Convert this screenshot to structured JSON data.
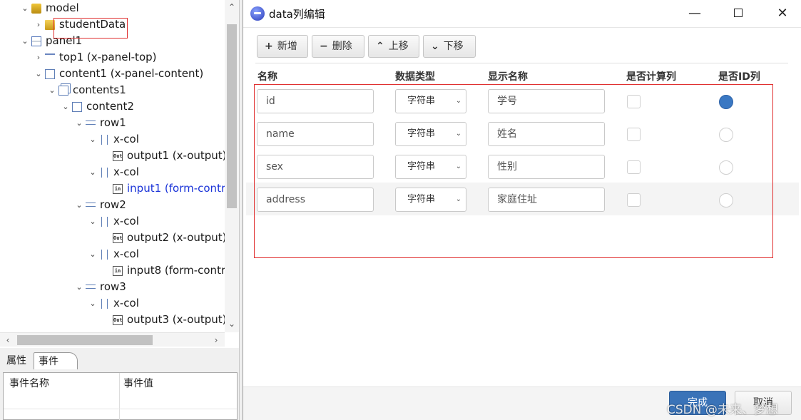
{
  "tree": {
    "items": [
      {
        "label": "model",
        "chevron": "⌄",
        "icon": "model"
      },
      {
        "label": "studentData",
        "chevron": "›",
        "icon": "data"
      },
      {
        "label": "panel1",
        "chevron": "⌄",
        "icon": "panel"
      },
      {
        "label": "top1 (x-panel-top)",
        "chevron": "›",
        "icon": "top"
      },
      {
        "label": "content1 (x-panel-content)",
        "chevron": "⌄",
        "icon": "square"
      },
      {
        "label": "contents1",
        "chevron": "⌄",
        "icon": "contents"
      },
      {
        "label": "content2",
        "chevron": "⌄",
        "icon": "square"
      },
      {
        "label": "row1",
        "chevron": "⌄",
        "icon": "row"
      },
      {
        "label": "x-col",
        "chevron": "⌄",
        "icon": "col"
      },
      {
        "label": "output1 (x-output)",
        "chevron": "",
        "icon": "out"
      },
      {
        "label": "x-col",
        "chevron": "⌄",
        "icon": "col"
      },
      {
        "label": "input1 (form-contr",
        "chevron": "",
        "icon": "in",
        "selected": true
      },
      {
        "label": "row2",
        "chevron": "⌄",
        "icon": "row"
      },
      {
        "label": "x-col",
        "chevron": "⌄",
        "icon": "col"
      },
      {
        "label": "output2 (x-output)",
        "chevron": "",
        "icon": "out"
      },
      {
        "label": "x-col",
        "chevron": "⌄",
        "icon": "col"
      },
      {
        "label": "input8 (form-contr",
        "chevron": "",
        "icon": "in"
      },
      {
        "label": "row3",
        "chevron": "⌄",
        "icon": "row"
      },
      {
        "label": "x-col",
        "chevron": "⌄",
        "icon": "col"
      },
      {
        "label": "output3 (x-output)",
        "chevron": "",
        "icon": "out"
      }
    ],
    "icon_text_out": "Out",
    "icon_text_in": "in"
  },
  "props": {
    "tab_properties": "属性",
    "tab_events": "事件",
    "col_event_name": "事件名称",
    "col_event_value": "事件值"
  },
  "dialog": {
    "title": "data列编辑",
    "toolbar": {
      "add": "新增",
      "delete": "删除",
      "move_up": "上移",
      "move_down": "下移"
    },
    "headers": {
      "name": "名称",
      "type": "数据类型",
      "display": "显示名称",
      "is_calc": "是否计算列",
      "is_id": "是否ID列"
    },
    "rows": [
      {
        "name": "id",
        "type": "字符串",
        "display": "学号",
        "calc": false,
        "id": true
      },
      {
        "name": "name",
        "type": "字符串",
        "display": "姓名",
        "calc": false,
        "id": false
      },
      {
        "name": "sex",
        "type": "字符串",
        "display": "性别",
        "calc": false,
        "id": false
      },
      {
        "name": "address",
        "type": "字符串",
        "display": "家庭住址",
        "calc": false,
        "id": false
      }
    ],
    "footer": {
      "done": "完成",
      "cancel": "取消"
    },
    "watermark": "CSDN @未来、梦想"
  },
  "colors": {
    "primary": "#3a73b8",
    "highlight_border": "#e03030",
    "selected_tree_text": "#1a33d8"
  }
}
